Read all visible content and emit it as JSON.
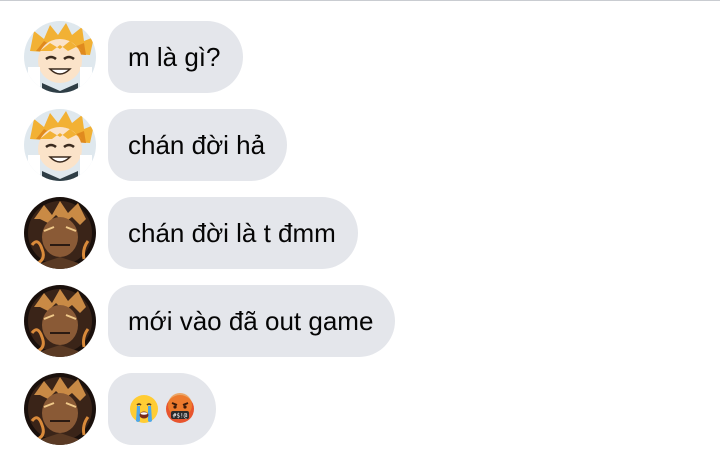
{
  "messages": [
    {
      "avatar": "zenitsu-smiling-avatar",
      "text": "m là gì?"
    },
    {
      "avatar": "zenitsu-smiling-avatar",
      "text": "chán đời hả"
    },
    {
      "avatar": "zenitsu-dark-avatar",
      "text": "chán đời là t đmm"
    },
    {
      "avatar": "zenitsu-dark-avatar",
      "text": "mới vào đã out game"
    },
    {
      "avatar": "zenitsu-dark-avatar",
      "emojis": [
        "loudly-crying-face-emoji",
        "face-with-symbols-on-mouth-emoji"
      ]
    }
  ],
  "colors": {
    "bubble": "#e4e6eb",
    "text": "#050505",
    "top_border": "#c9ccd1"
  }
}
